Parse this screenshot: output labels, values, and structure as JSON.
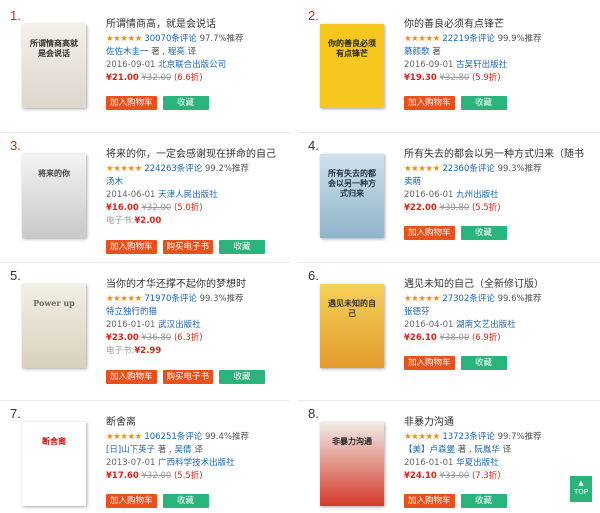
{
  "buttons": {
    "cart": "加入购物车",
    "ebook": "购买电子书",
    "fav": "收藏"
  },
  "ebook_label": "电子书:",
  "back_to_top": "TOP",
  "books": [
    {
      "rank": "1.",
      "title": "所谓情商高，就是会说话",
      "reviews": "30070条评论",
      "recommend": "97.7%推荐",
      "author": "佐佐木圭一",
      "author_role": "著",
      "translator": "程亮",
      "translator_role": "译",
      "date": "2016-09-01",
      "publisher": "北京联合出版公司",
      "price": "¥21.00",
      "original_price": "¥32.00",
      "discount": "(6.6折)",
      "ebook_price": null,
      "cover_text": "所谓情商高就是会说话"
    },
    {
      "rank": "2.",
      "title": "你的善良必须有点锋芒",
      "reviews": "22219条评论",
      "recommend": "99.9%推荐",
      "author": "慕颜歌",
      "author_role": "著",
      "date": "2016-09-01",
      "publisher": "古吴轩出版社",
      "price": "¥19.30",
      "original_price": "¥32.80",
      "discount": "(5.9折)",
      "ebook_price": null,
      "cover_text": "你的善良必须有点锋芒"
    },
    {
      "rank": "3.",
      "title": "将来的你，一定会感谢现在拼命的自己",
      "reviews": "224263条评论",
      "recommend": "99.2%推荐",
      "author": "汤木",
      "date": "2014-06-01",
      "publisher": "天津人民出版社",
      "price": "¥16.00",
      "original_price": "¥32.00",
      "discount": "(5.0折)",
      "ebook_price": "¥2.00",
      "cover_text": "将来的你"
    },
    {
      "rank": "4.",
      "title": "所有失去的都会以另一种方式归来（随书",
      "reviews": "22360条评论",
      "recommend": "99.3%推荐",
      "author": "卖萌",
      "date": "2016-06-01",
      "publisher": "九州出版社",
      "price": "¥22.00",
      "original_price": "¥39.80",
      "discount": "(5.5折)",
      "ebook_price": null,
      "cover_text": "所有失去的都会以另一种方式归来"
    },
    {
      "rank": "5.",
      "title": "当你的才华还撑不起你的梦想时",
      "reviews": "71970条评论",
      "recommend": "99.3%推荐",
      "author": "特立独行的猫",
      "date": "2016-01-01",
      "publisher": "武汉出版社",
      "price": "¥23.00",
      "original_price": "¥36.80",
      "discount": "(6.3折)",
      "ebook_price": "¥2.99",
      "cover_text": "Power up"
    },
    {
      "rank": "6.",
      "title": "遇见未知的自己（全新修订版）",
      "reviews": "27302条评论",
      "recommend": "99.6%推荐",
      "author": "张德芬",
      "date": "2016-04-01",
      "publisher": "湖南文艺出版社",
      "price": "¥26.10",
      "original_price": "¥38.00",
      "discount": "(6.9折)",
      "ebook_price": null,
      "cover_text": "遇见未知的自己"
    },
    {
      "rank": "7.",
      "title": "断舍离",
      "reviews": "106251条评论",
      "recommend": "99.4%推荐",
      "author": "[日]山下英子",
      "author_role": "著",
      "translator": "吴倩",
      "translator_role": "译",
      "date": "2013-07-01",
      "publisher": "广西科学技术出版社",
      "price": "¥17.60",
      "original_price": "¥32.00",
      "discount": "(5.5折)",
      "ebook_price": null,
      "cover_text": "断舍离"
    },
    {
      "rank": "8.",
      "title": "非暴力沟通",
      "reviews": "13723条评论",
      "recommend": "99.7%推荐",
      "author": "【美】卢森堡",
      "author_role": "著",
      "translator": "阮胤华",
      "translator_role": "译",
      "date": "2016-01-01",
      "publisher": "华夏出版社",
      "price": "¥24.10",
      "original_price": "¥33.00",
      "discount": "(7.3折)",
      "ebook_price": null,
      "cover_text": "非暴力沟通"
    }
  ],
  "colors": {
    "rank_odd": "#d6281c",
    "rank_even": "#d6281c",
    "star": "#ff8a00",
    "link": "#1a66b3",
    "price": "#d6281c",
    "cart_button": "#e8501c",
    "fav_button": "#2ab37a"
  }
}
